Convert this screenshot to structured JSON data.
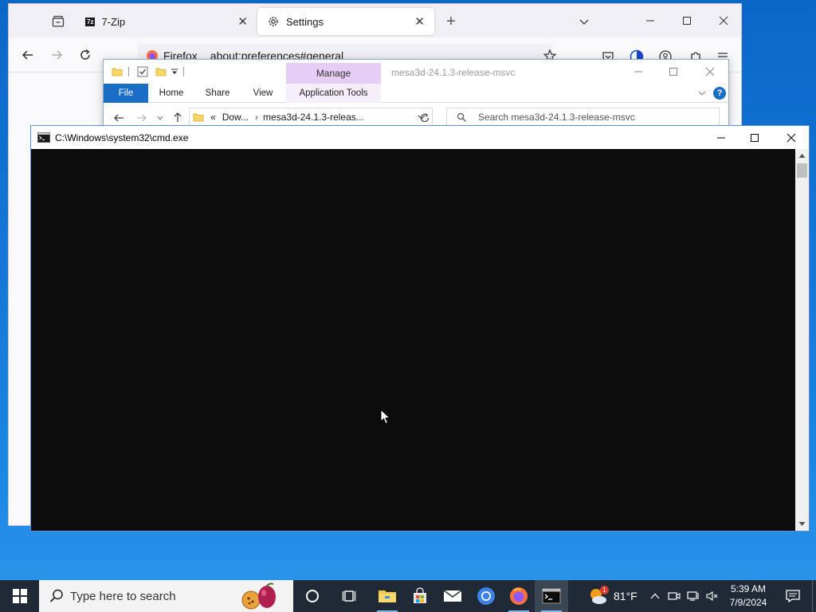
{
  "firefox": {
    "tabs": [
      {
        "label": "7-Zip"
      },
      {
        "label": "Settings"
      }
    ],
    "new_tab": "+",
    "url_brand": "Firefox",
    "url": "about:preferences#general"
  },
  "explorer": {
    "contextual_tab": "Manage",
    "window_title": "mesa3d-24.1.3-release-msvc",
    "ribbon_tabs": [
      "File",
      "Home",
      "Share",
      "View",
      "Application Tools"
    ],
    "breadcrumb": {
      "overflow": "«",
      "parent": "Dow...",
      "separator": "›",
      "current": "mesa3d-24.1.3-releas..."
    },
    "search_placeholder": "Search mesa3d-24.1.3-release-msvc"
  },
  "cmd": {
    "title": "C:\\Windows\\system32\\cmd.exe"
  },
  "taskbar": {
    "search_placeholder": "Type here to search",
    "weather": {
      "temperature": "81°F",
      "badge": "1"
    },
    "clock": {
      "time": "5:39 AM",
      "date": "7/9/2024"
    }
  },
  "colors": {
    "desktop": "#1578d8",
    "taskbar": "#1f2a36",
    "console": "#0c0c0c",
    "explorer_accent": "#1a6fc4",
    "manage_tab": "#e6cdf5"
  }
}
